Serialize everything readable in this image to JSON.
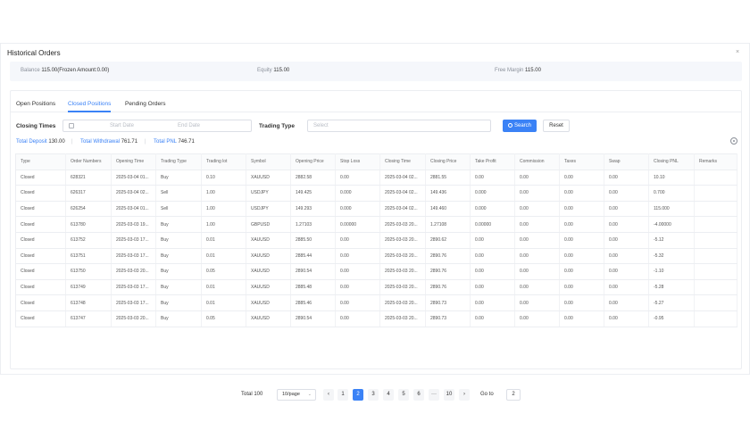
{
  "modal": {
    "title": "Historical Orders",
    "close": "×"
  },
  "balance": {
    "balance_label": "Balance",
    "balance_value": "115.00(Frozen Amount:0.00)",
    "equity_label": "Equity",
    "equity_value": "115.00",
    "free_margin_label": "Free Margin",
    "free_margin_value": "115.00"
  },
  "tabs": [
    {
      "label": "Open Positions"
    },
    {
      "label": "Closed Positions",
      "active": true
    },
    {
      "label": "Pending Orders"
    }
  ],
  "filters": {
    "closing_times_label": "Closing Times",
    "start_placeholder": "Start Date",
    "end_placeholder": "End Date",
    "trading_type_label": "Trading Type",
    "select_placeholder": "Select",
    "search_label": "Search",
    "reset_label": "Reset"
  },
  "totals": {
    "deposit_label": "Total Deposit",
    "deposit_value": "130.00",
    "withdrawal_label": "Total Withdrawal",
    "withdrawal_value": "761.71",
    "pnl_label": "Total PNL",
    "pnl_value": "746.71"
  },
  "table": {
    "columns": [
      "Type",
      "Order Numbers",
      "Opening Time",
      "Trading Type",
      "Trading lot",
      "Symbol",
      "Opening Price",
      "Stop Loss",
      "Closing Time",
      "Closing Price",
      "Take Profit",
      "Commission",
      "Taxes",
      "Swap",
      "Closing PNL",
      "Remarks"
    ],
    "rows": [
      [
        "Closed",
        "628321",
        "2025-03-04 01...",
        "Buy",
        "0.10",
        "XAUUSD",
        "2882.58",
        "0.00",
        "2025-03-04 02...",
        "2881.55",
        "0.00",
        "0.00",
        "0.00",
        "0.00",
        "10.10",
        ""
      ],
      [
        "Closed",
        "626317",
        "2025-03-04 02...",
        "Sell",
        "1.00",
        "USDJPY",
        "149.425",
        "0.000",
        "2025-03-04 02...",
        "149.436",
        "0.000",
        "0.00",
        "0.00",
        "0.00",
        "0.700",
        ""
      ],
      [
        "Closed",
        "626254",
        "2025-03-04 01...",
        "Sell",
        "1.00",
        "USDJPY",
        "149.293",
        "0.000",
        "2025-03-04 02...",
        "149.460",
        "0.000",
        "0.00",
        "0.00",
        "0.00",
        "115.000",
        ""
      ],
      [
        "Closed",
        "613780",
        "2025-03-03 19...",
        "Buy",
        "1.00",
        "GBPUSD",
        "1.27103",
        "0.00000",
        "2025-03-03 20...",
        "1.27108",
        "0.00000",
        "0.00",
        "0.00",
        "0.00",
        "-4.00000",
        ""
      ],
      [
        "Closed",
        "613752",
        "2025-03-03 17...",
        "Buy",
        "0.01",
        "XAUUSD",
        "2885.50",
        "0.00",
        "2025-03-03 20...",
        "2890.62",
        "0.00",
        "0.00",
        "0.00",
        "0.00",
        "-5.12",
        ""
      ],
      [
        "Closed",
        "613751",
        "2025-03-03 17...",
        "Buy",
        "0.01",
        "XAUUSD",
        "2885.44",
        "0.00",
        "2025-03-03 20...",
        "2890.76",
        "0.00",
        "0.00",
        "0.00",
        "0.00",
        "-5.32",
        ""
      ],
      [
        "Closed",
        "613750",
        "2025-03-03 20...",
        "Buy",
        "0.05",
        "XAUUSD",
        "2890.54",
        "0.00",
        "2025-03-03 20...",
        "2890.76",
        "0.00",
        "0.00",
        "0.00",
        "0.00",
        "-1.10",
        ""
      ],
      [
        "Closed",
        "613749",
        "2025-03-03 17...",
        "Buy",
        "0.01",
        "XAUUSD",
        "2885.48",
        "0.00",
        "2025-03-03 20...",
        "2890.76",
        "0.00",
        "0.00",
        "0.00",
        "0.00",
        "-5.28",
        ""
      ],
      [
        "Closed",
        "613748",
        "2025-03-03 17...",
        "Buy",
        "0.01",
        "XAUUSD",
        "2885.46",
        "0.00",
        "2025-03-03 20...",
        "2890.73",
        "0.00",
        "0.00",
        "0.00",
        "0.00",
        "-5.27",
        ""
      ],
      [
        "Closed",
        "613747",
        "2025-03-03 20...",
        "Buy",
        "0.05",
        "XAUUSD",
        "2890.54",
        "0.00",
        "2025-03-03 20...",
        "2890.73",
        "0.00",
        "0.00",
        "0.00",
        "0.00",
        "-0.95",
        ""
      ]
    ]
  },
  "pagination": {
    "total_label": "Total 100",
    "page_size": "10/page",
    "prev": "‹",
    "next": "›",
    "pages": [
      "1",
      "2",
      "3",
      "4",
      "5",
      "6",
      "···",
      "10"
    ],
    "current": "2",
    "goto_label": "Go to",
    "goto_value": "2"
  },
  "colors": {
    "accent": "#3b82f6",
    "border": "#eceef2"
  }
}
